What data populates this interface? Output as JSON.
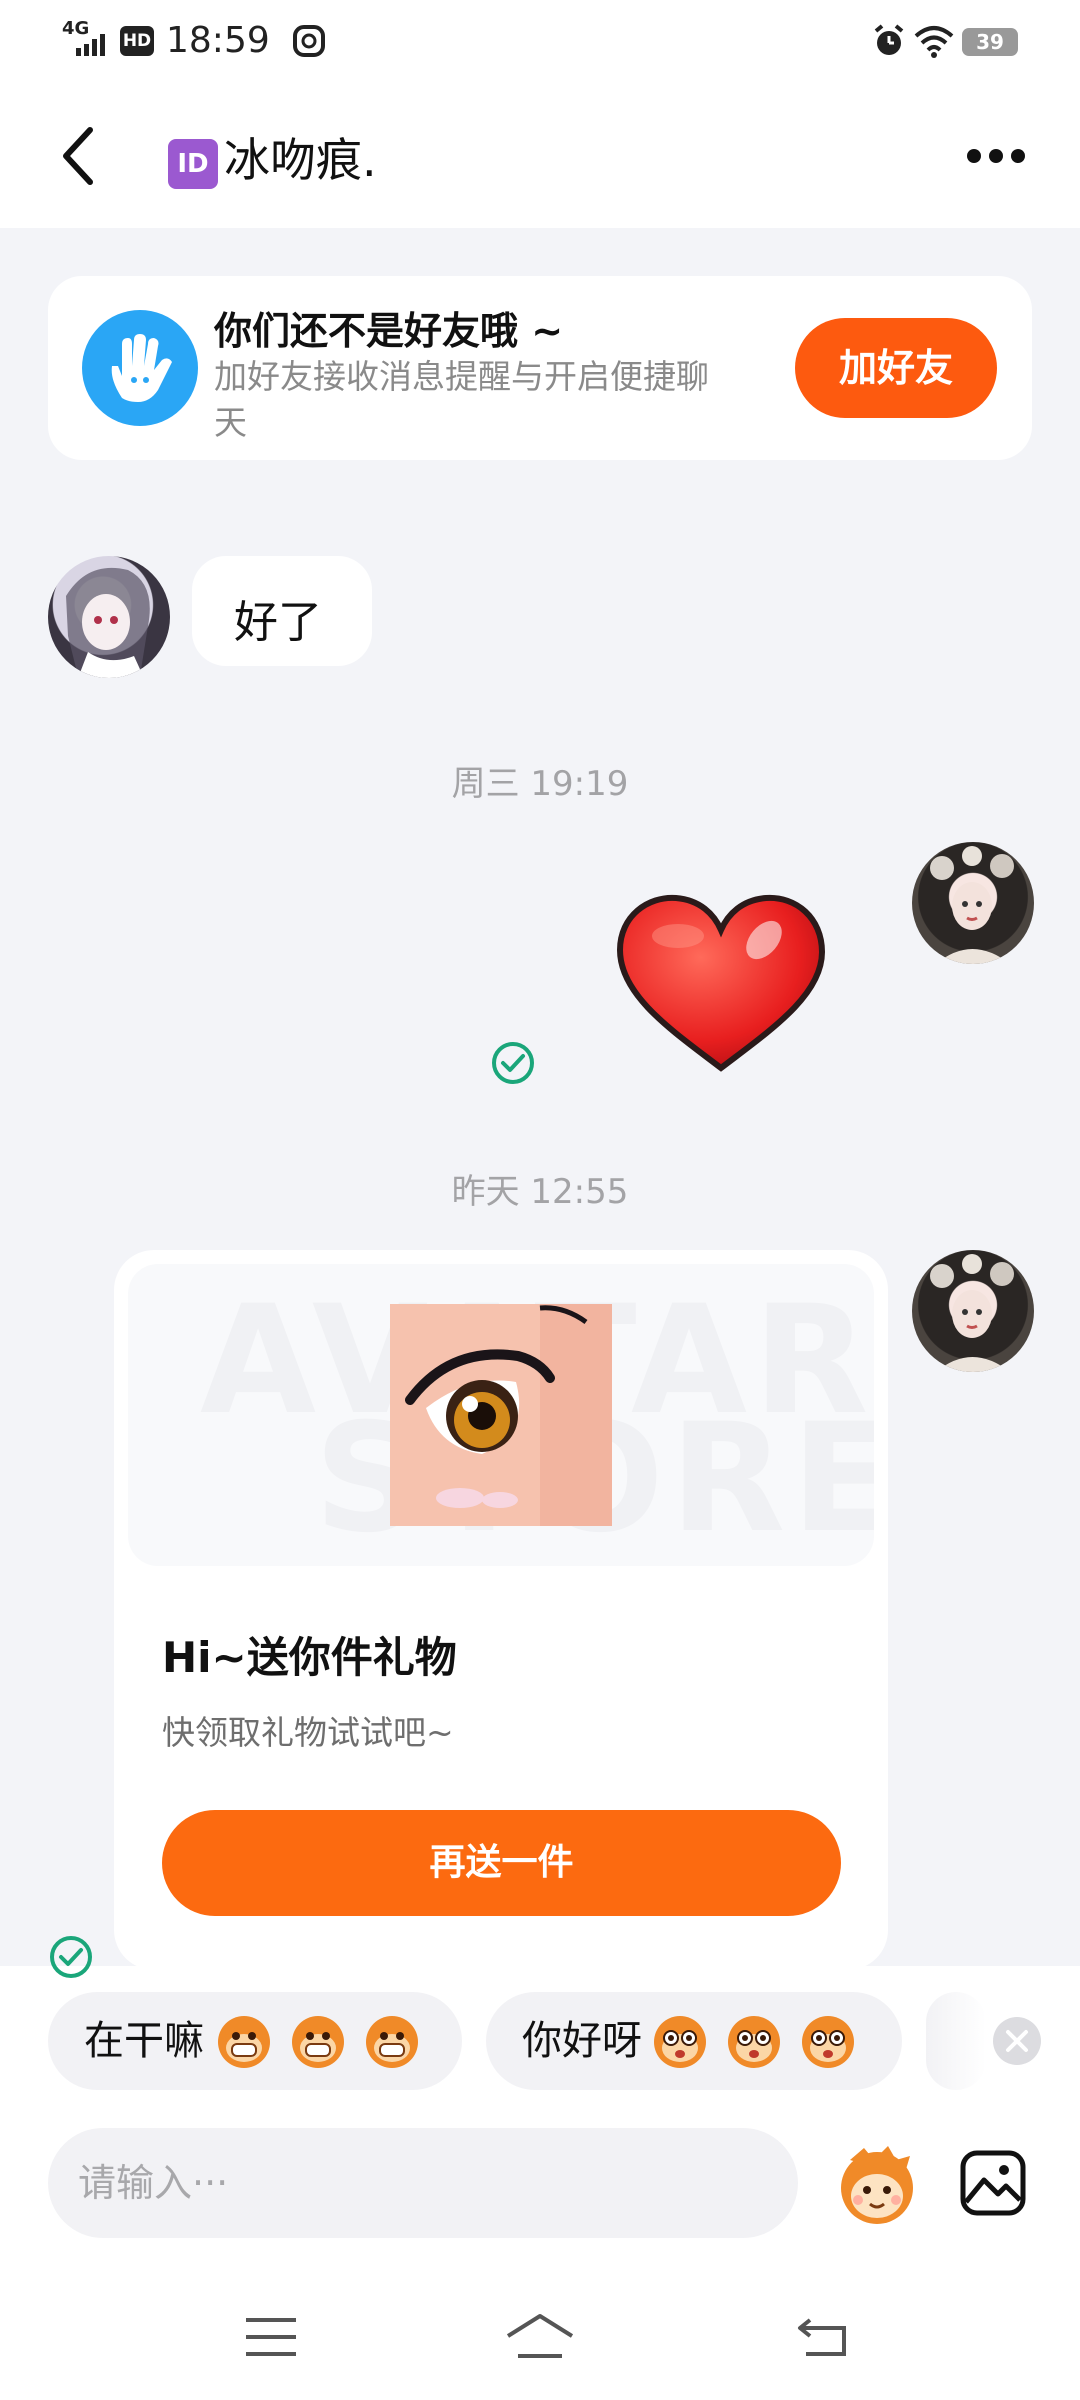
{
  "status_bar": {
    "network": "4G",
    "hd": "HD",
    "time": "18:59",
    "battery": "39"
  },
  "header": {
    "id_badge": "ID",
    "title": "冰吻痕."
  },
  "banner": {
    "title": "你们还不是好友哦 ~",
    "desc_line1": "加好友接收消息提醒与开启便捷聊",
    "desc_line2": "天",
    "button": "加好友"
  },
  "messages": {
    "incoming_text": "好了",
    "time1": "周三 19:19",
    "time2": "昨天 12:55"
  },
  "gift_card": {
    "watermark_line1": "AVATAR",
    "watermark_line2": "STORE",
    "title": "Hi~送你件礼物",
    "subtitle": "快领取礼物试试吧~",
    "button": "再送一件"
  },
  "quick_replies": [
    {
      "label": "在干嘛"
    },
    {
      "label": "你好呀"
    }
  ],
  "input": {
    "placeholder": "请输入···"
  },
  "colors": {
    "accent": "#fd5a0f",
    "check": "#1aa67a",
    "background": "#f3f4f8"
  }
}
